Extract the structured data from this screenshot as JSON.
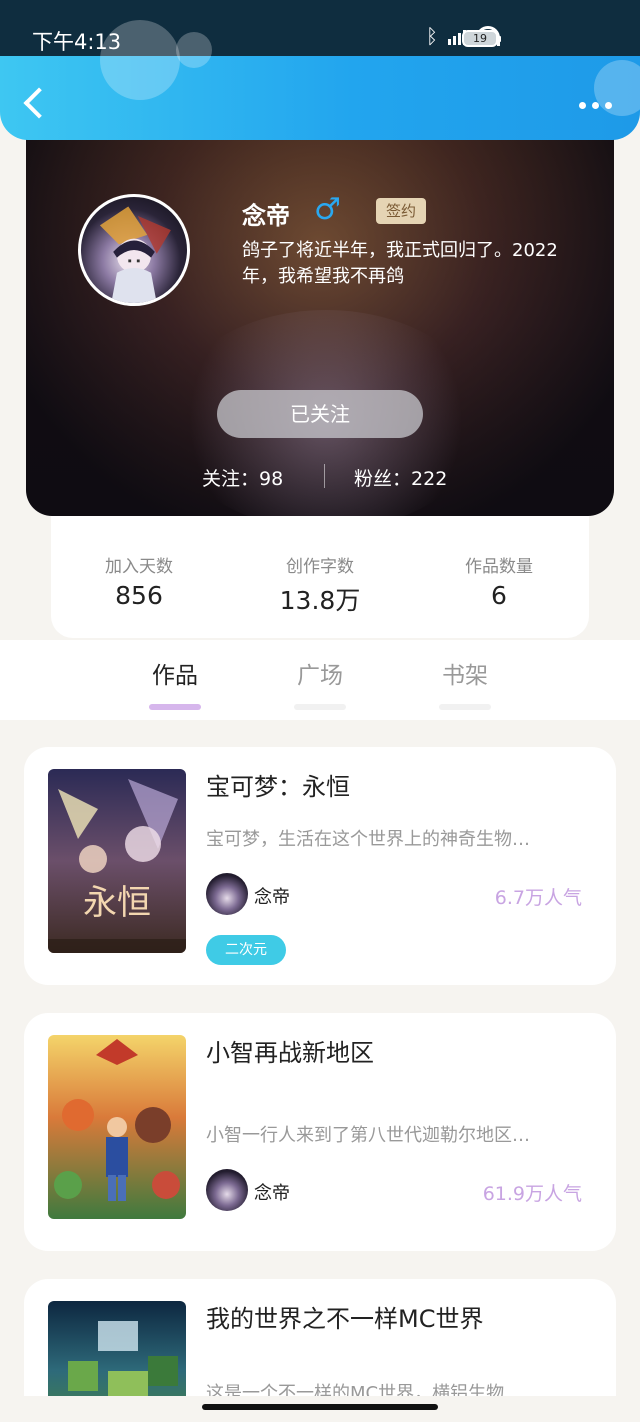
{
  "status_bar": {
    "time": "下午4:13",
    "battery": "19"
  },
  "profile": {
    "name": "念帝",
    "gender_symbol": "♂",
    "badge": "签约",
    "bio": "鸽子了将近半年，我正式回归了。2022年，我希望我不再鸽",
    "follow_button": "已关注",
    "following_label": "关注：",
    "following_count": "98",
    "fans_label": "粉丝：",
    "fans_count": "222"
  },
  "stats": [
    {
      "label": "加入天数",
      "value": "856"
    },
    {
      "label": "创作字数",
      "value": "13.8万"
    },
    {
      "label": "作品数量",
      "value": "6"
    }
  ],
  "tabs": [
    {
      "label": "作品",
      "active": true
    },
    {
      "label": "广场",
      "active": false
    },
    {
      "label": "书架",
      "active": false
    }
  ],
  "works": [
    {
      "title": "宝可梦：永恒",
      "description": "宝可梦，生活在这个世界上的神奇生物…",
      "author": "念帝",
      "popularity": "6.7万人气",
      "tag": "二次元"
    },
    {
      "title": "小智再战新地区",
      "description": "小智一行人来到了第八世代迦勒尔地区…",
      "author": "念帝",
      "popularity": "61.9万人气",
      "tag": ""
    },
    {
      "title": "我的世界之不一样MC世界",
      "description": "这是一个不一样的MC世界，横铝生物…",
      "author": "",
      "popularity": "",
      "tag": ""
    }
  ],
  "colors": {
    "header_blue": "#22a5ee",
    "accent_purple": "#c8a4e2",
    "tag_cyan": "#3fcbe6",
    "badge_gold": "#e5d4b4"
  }
}
